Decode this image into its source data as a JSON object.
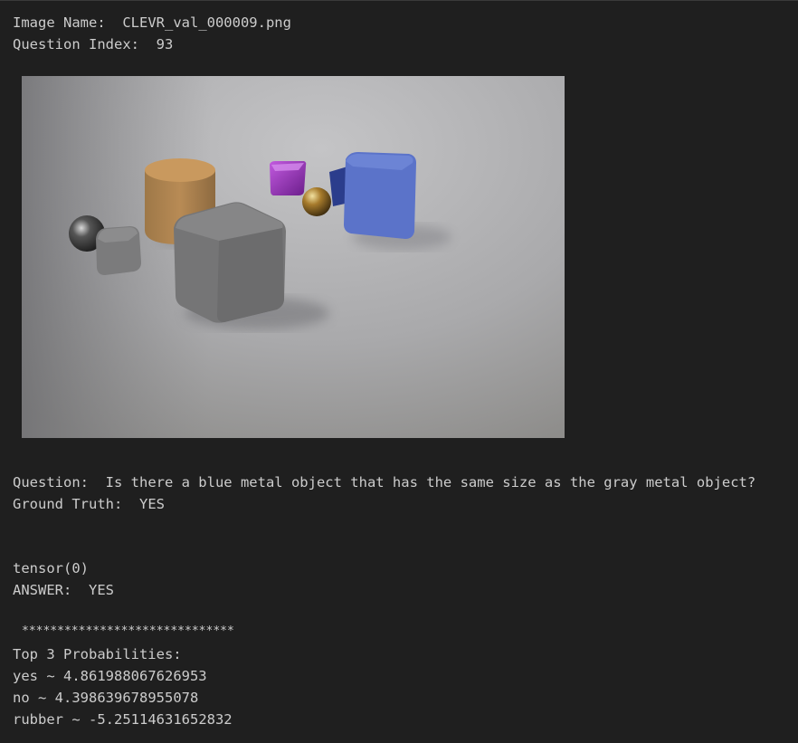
{
  "header": {
    "image_name_label": "Image Name:  ",
    "image_name_value": "CLEVR_val_000009.png",
    "question_index_label": "Question Index:  ",
    "question_index_value": "93"
  },
  "qa": {
    "question_label": "Question:  ",
    "question_text": "Is there a blue metal object that has the same size as the gray metal object?",
    "ground_truth_label": "Ground Truth:  ",
    "ground_truth_value": "YES"
  },
  "output": {
    "tensor_line": "tensor(0)",
    "answer_label": "ANSWER:  ",
    "answer_value": "YES",
    "separator": "******************************",
    "top_title": "Top 3 Probabilities:",
    "probabilities": [
      {
        "label": "yes",
        "sep": " ~ ",
        "value": "4.861988067626953"
      },
      {
        "label": "no",
        "sep": " ~ ",
        "value": "4.398639678955078"
      },
      {
        "label": "rubber",
        "sep": " ~ ",
        "value": "-5.25114631652832"
      }
    ]
  },
  "colors": {
    "background": "#1f1f1f",
    "text": "#cccccc"
  }
}
